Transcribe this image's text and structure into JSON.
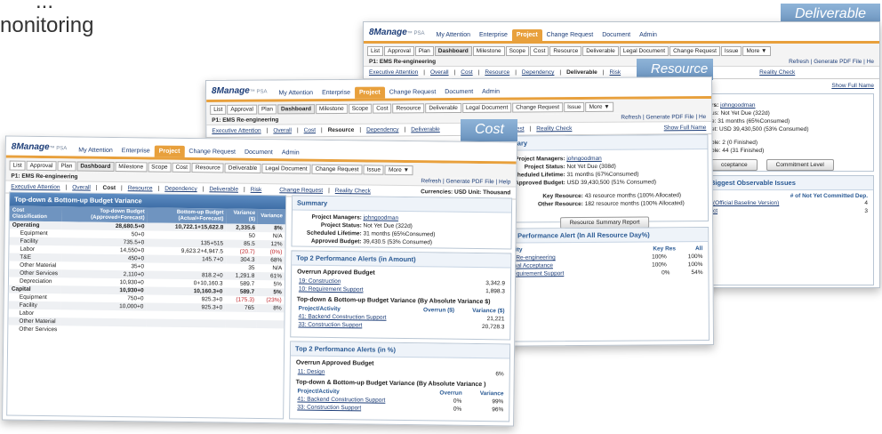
{
  "hero": {
    "line1": "...",
    "line2": "nonitoring"
  },
  "labels": {
    "deliverable": "Deliverable",
    "resource": "Resource",
    "cost": "Cost"
  },
  "logo": {
    "brand": "8Manage",
    "suffix": "PSA"
  },
  "topnav": [
    "My Attention",
    "Enterprise",
    "Project",
    "Change Request",
    "Document",
    "Admin"
  ],
  "subtabs": [
    "List",
    "Approval",
    "Plan",
    "Dashboard",
    "Milestone",
    "Scope",
    "Cost",
    "Resource",
    "Deliverable",
    "Legal Document",
    "Change Request",
    "Issue",
    "More ▼"
  ],
  "project": {
    "name": "P1: EMS Re-engineering",
    "refresh": "Refresh",
    "pdf": "Generate PDF File",
    "help": "Help",
    "he": "He"
  },
  "views": {
    "exec": "Executive Attention",
    "overall": "Overall",
    "cost": "Cost",
    "resource": "Resource",
    "dependency": "Dependency",
    "deliverable": "Deliverable",
    "risk": "Risk",
    "change": "Change Request",
    "reality": "Reality Check",
    "fullname": "Show Full Name",
    "currencies": "Currencies: USD Unit: Thousand"
  },
  "deliverable": {
    "info": {
      "pm": "rs:",
      "pm_val": "johngoodman",
      "status": "us: Not Yet Due (322d)",
      "life": "e: 31 months (65%Consumed)",
      "budget": "et: USD 39,430,500 (53% Consumed)",
      "d1": "ble: 2 (0 Finished)",
      "d2": "ble: 44 (31 Finished)"
    },
    "btn_accept": "cceptance",
    "btn_commit": "Commitment Level",
    "issues_title": "Biggest Observable Issues",
    "issues_col": "# of Not Yet Committed Dep.",
    "issues_rows": [
      {
        "name": "(Official Baseline Version)",
        "val": "4"
      },
      {
        "name": "ct",
        "val": "3"
      }
    ]
  },
  "resource": {
    "summary": "mmary",
    "pm_label": "Project Managers:",
    "pm_val": "johngoodman",
    "status_label": "Project Status:",
    "status_val": "Not Yet Due (308d)",
    "life_label": "Scheduled Lifetime:",
    "life_val": "31 months (67%Consumed)",
    "budget_label": "Approved Budget:",
    "budget_val": "USD 39,430,500 (51% Consumed)",
    "key_label": "Key Resource:",
    "key_val": "43 resource months (100% Allocated)",
    "other_label": "Other Resource:",
    "other_val": "182 resource months (100% Allocated)",
    "summary_btn": "Resource Summary Report",
    "alert_title": "p 2 Performance Alert (In All Resource Day%)",
    "cols": [
      "tivity",
      "Key Res",
      "All"
    ],
    "rows": [
      {
        "name": "IS Re-engineering",
        "a": "100%",
        "b": "100%"
      },
      {
        "name": "Final Acceptance",
        "a": "100%",
        "b": "100%"
      },
      {
        "name": "Requirement Support",
        "a": "0%",
        "b": "54%"
      }
    ]
  },
  "cost": {
    "variance_title": "Top-down & Bottom-up Budget Variance",
    "cols": [
      "Cost Classification",
      "Top-down Budget (Approved+Forecast)",
      "Bottom-up Budget (Actual+Forecast)",
      "Variance ($)",
      "Variance"
    ],
    "rows": [
      {
        "grp": true,
        "name": "Operating",
        "td": "28,680.5+0",
        "bu": "10,722.1+15,622.8",
        "v": "2,335.6",
        "p": "8%"
      },
      {
        "name": "Equipment",
        "td": "50+0",
        "bu": "",
        "v": "50",
        "p": "N/A"
      },
      {
        "name": "Facility",
        "td": "735.5+0",
        "bu": "135+515",
        "v": "85.5",
        "p": "12%"
      },
      {
        "name": "Labor",
        "td": "14,550+0",
        "bu": "9,623.2+4,947.5",
        "v": "(20.7)",
        "p": "(0%)",
        "neg": true
      },
      {
        "name": "T&E",
        "td": "450+0",
        "bu": "145.7+0",
        "v": "304.3",
        "p": "68%"
      },
      {
        "name": "Other Material",
        "td": "35+0",
        "bu": "",
        "v": "35",
        "p": "N/A"
      },
      {
        "name": "Other Services",
        "td": "2,110+0",
        "bu": "818.2+0",
        "v": "1,291.8",
        "p": "61%"
      },
      {
        "name": "Depreciation",
        "td": "10,930+0",
        "bu": "0+10,160.3",
        "v": "589.7",
        "p": "5%"
      },
      {
        "grp": true,
        "name": "Capital",
        "td": "10,930+0",
        "bu": "10,160.3+0",
        "v": "589.7",
        "p": "5%"
      },
      {
        "name": "Equipment",
        "td": "750+0",
        "bu": "925.3+0",
        "v": "(175.3)",
        "p": "(23%)",
        "neg": true
      },
      {
        "name": "Facility",
        "td": "10,000+0",
        "bu": "925.3+0",
        "v": "765",
        "p": "8%"
      },
      {
        "name": "Labor",
        "td": "",
        "bu": "",
        "v": "",
        "p": ""
      },
      {
        "name": "Other Material",
        "td": "",
        "bu": "",
        "v": "",
        "p": ""
      },
      {
        "name": "Other Services",
        "td": "",
        "bu": "",
        "v": "",
        "p": ""
      }
    ],
    "summary": {
      "title": "Summary",
      "pm_label": "Project Managers:",
      "pm_val": "johngoodman",
      "status_label": "Project Status:",
      "status_val": "Not Yet Due (322d)",
      "life_label": "Scheduled Lifetime:",
      "life_val": "31 months (65%Consumed)",
      "budget_label": "Approved Budget:",
      "budget_val": "39,430.5 (53% Consumed)"
    },
    "amount": {
      "title": "Top 2 Performance Alerts (in Amount)",
      "overrun": "Overrun Approved Budget",
      "o_rows": [
        {
          "name": "19: Construction",
          "val": "3,342.9"
        },
        {
          "name": "10: Requirement Support",
          "val": "1,898.3"
        }
      ],
      "var_title": "Top-down & Bottom-up Budget Variance (By Absolute Variance $)",
      "cols": [
        "Project/Activity",
        "Overrun ($)",
        "Variance ($)"
      ],
      "v_rows": [
        {
          "name": "41: Backend Construction Support",
          "val": "21,221"
        },
        {
          "name": "33: Construction Support",
          "val": "20,728.3"
        }
      ]
    },
    "percent": {
      "title": "Top 2 Performance Alerts (in %)",
      "overrun": "Overrun Approved Budget",
      "o_rows": [
        {
          "name": "11: Design",
          "val": "6%"
        }
      ],
      "var_title": "Top-down & Bottom-up Budget Variance (By Absolute Variance )",
      "cols": [
        "Project/Activity",
        "Overrun",
        "Variance"
      ],
      "v_rows": [
        {
          "name": "41: Backend Construction Support",
          "a": "0%",
          "b": "99%"
        },
        {
          "name": "33: Construction Support",
          "a": "0%",
          "b": "96%"
        }
      ]
    }
  }
}
